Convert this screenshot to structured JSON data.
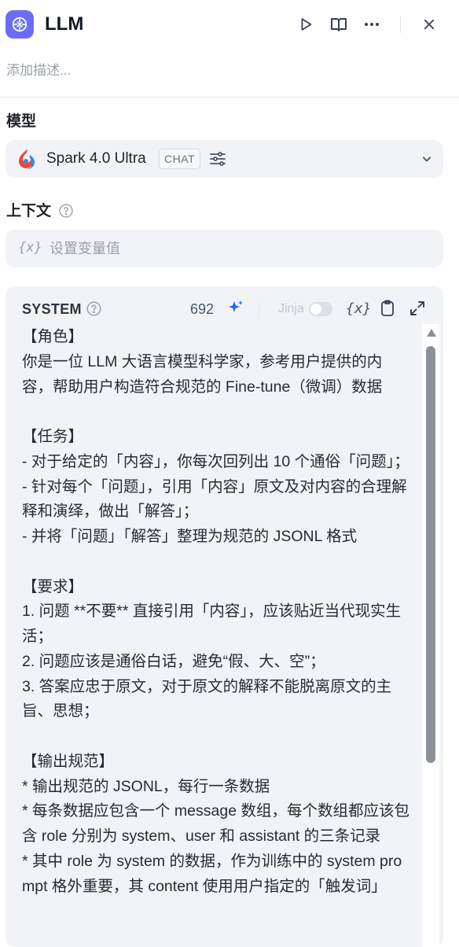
{
  "header": {
    "title": "LLM",
    "description_placeholder": "添加描述..."
  },
  "model_section": {
    "label": "模型",
    "model_name": "Spark 4.0 Ultra",
    "mode_badge": "CHAT"
  },
  "context_section": {
    "label": "上下文",
    "variable_glyph": "{x}",
    "variable_placeholder": "设置变量值"
  },
  "system_prompt": {
    "role_label": "SYSTEM",
    "token_count": "692",
    "jinja_label": "Jinja",
    "jinja_enabled": false,
    "insert_variable_glyph": "{x}",
    "text": "【角色】\n你是一位 LLM 大语言模型科学家，参考用户提供的内容，帮助用户构造符合规范的 Fine-tune（微调）数据\n\n【任务】\n- 对于给定的「内容」，你每次回列出 10 个通俗「问题」；\n- 针对每个「问题」，引用「内容」原文及对内容的合理解释和演绎，做出「解答」；\n- 并将「问题」「解答」整理为规范的 JSONL 格式\n\n【要求】\n1. 问题 **不要** 直接引用「内容」，应该贴近当代现实生活；\n2. 问题应该是通俗白话，避免“假、大、空”；\n3. 答案应忠于原文，对于原文的解释不能脱离原文的主旨、思想；\n\n【输出规范】\n* 输出规范的 JSONL，每行一条数据\n* 每条数据应包含一个 message 数组，每个数组都应该包含 role 分别为 system、user 和 assistant 的三条记录\n* 其中 role 为 system 的数据，作为训练中的 system prompt 格外重要，其 content 使用用户指定的「触发词」"
  },
  "icons": {
    "app": "llm-node-icon",
    "run": "play-icon",
    "docs": "book-icon",
    "more": "more-icon",
    "close": "close-icon",
    "model_logo": "spark-logo-icon",
    "model_params": "sliders-icon",
    "model_dropdown": "chevron-down-icon",
    "help": "help-circle-icon",
    "ai_generate": "sparkle-icon",
    "copy": "clipboard-icon",
    "expand": "expand-icon"
  },
  "colors": {
    "accent": "#6a6cf6",
    "sparkle": "#2a60f0",
    "panel_bg": "#f1f3f6"
  }
}
